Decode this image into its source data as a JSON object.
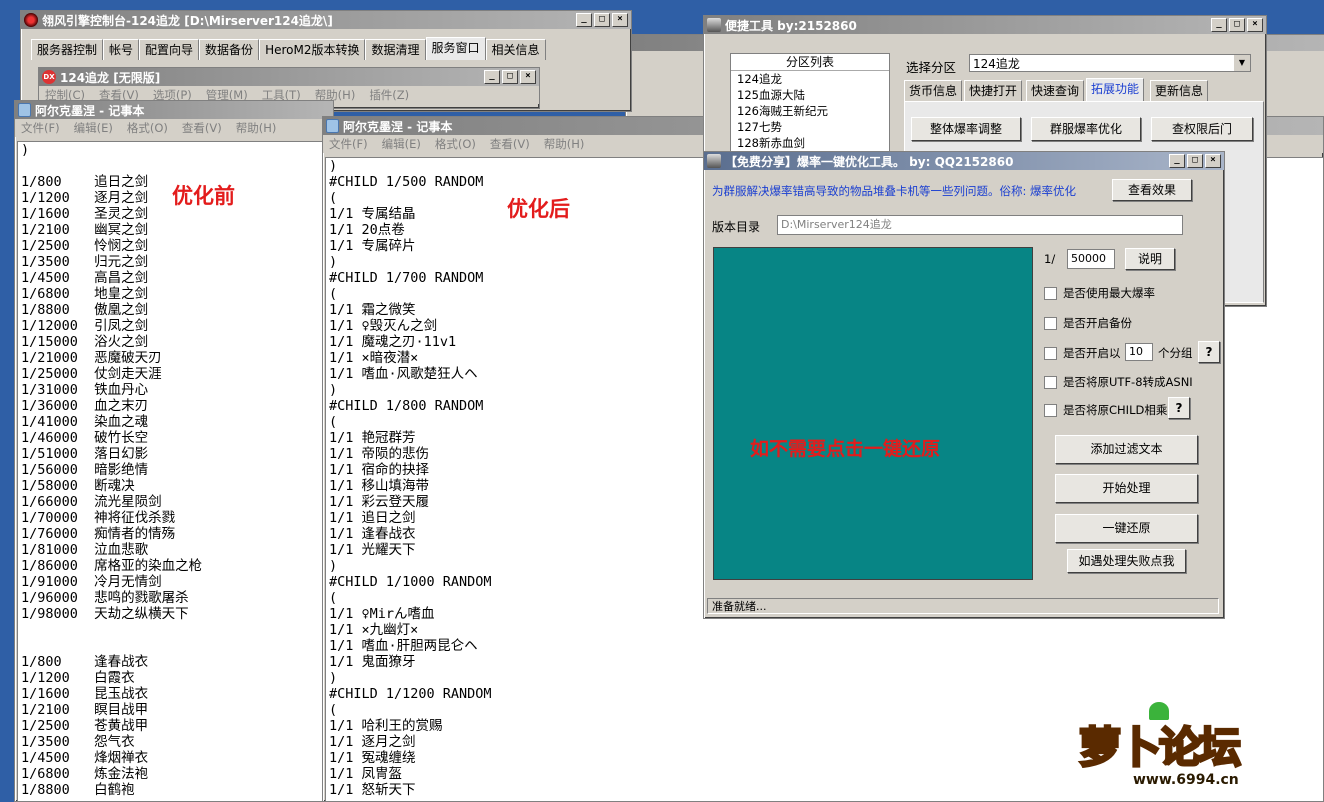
{
  "engine": {
    "title": "翎风引擎控制台-124追龙 [D:\\Mirserver124追龙\\]",
    "tabs": [
      "服务器控制",
      "帐号",
      "配置向导",
      "数据备份",
      "HeroM2版本转换",
      "数据清理",
      "服务窗口",
      "相关信息"
    ],
    "sub_title": "124追龙 [无限版]",
    "sub_menu": [
      "控制(C)",
      "查看(V)",
      "选项(P)",
      "管理(M)",
      "工具(T)",
      "帮助(H)",
      "插件(Z)"
    ]
  },
  "notepad_before": {
    "title": "阿尔克墨涅 - 记事本",
    "menu": [
      "文件(F)",
      "编辑(E)",
      "格式(O)",
      "查看(V)",
      "帮助(H)"
    ],
    "label": "优化前",
    "lines": [
      ")",
      "",
      "1/800    追日之剑",
      "1/1200   逐月之剑",
      "1/1600   圣灵之剑",
      "1/2100   幽冥之剑",
      "1/2500   怜悯之剑",
      "1/3500   归元之剑",
      "1/4500   高昌之剑",
      "1/6800   地皇之剑",
      "1/8800   傲凰之剑",
      "1/12000  引凤之剑",
      "1/15000  浴火之剑",
      "1/21000  恶魔破天刃",
      "1/25000  仗剑走天涯",
      "1/31000  铁血丹心",
      "1/36000  血之末刃",
      "1/41000  染血之魂",
      "1/46000  破竹长空",
      "1/51000  落日幻影",
      "1/56000  暗影绝情",
      "1/58000  断魂决",
      "1/66000  流光星陨剑",
      "1/70000  神将征伐杀戮",
      "1/76000  痴情者的情殇",
      "1/81000  泣血悲歌",
      "1/86000  席格亚的染血之枪",
      "1/91000  冷月无情剑",
      "1/96000  悲鸣的戮歌屠杀",
      "1/98000  天劫之纵横天下",
      "",
      "",
      "1/800    逢春战衣",
      "1/1200   白霞衣",
      "1/1600   昆玉战衣",
      "1/2100   瞑目战甲",
      "1/2500   苍黄战甲",
      "1/3500   怨气衣",
      "1/4500   烽烟禅衣",
      "1/6800   炼金法袍",
      "1/8800   白鹤袍"
    ]
  },
  "notepad_after": {
    "title": "阿尔克墨涅 - 记事本",
    "menu": [
      "文件(F)",
      "编辑(E)",
      "格式(O)",
      "查看(V)",
      "帮助(H)"
    ],
    "label": "优化后",
    "lines": [
      ")",
      "#CHILD 1/500 RANDOM",
      "(",
      "1/1 专属结晶",
      "1/1 20点卷",
      "1/1 专属碎片",
      ")",
      "#CHILD 1/700 RANDOM",
      "(",
      "1/1 霜之微笑",
      "1/1 ♀毁灭ん之剑",
      "1/1 魔魂之刃·11v1",
      "1/1 ×暗夜潜×",
      "1/1 嗜血·风歌楚狂人ヘ",
      ")",
      "#CHILD 1/800 RANDOM",
      "(",
      "1/1 艳冠群芳",
      "1/1 帝陨的悲伤",
      "1/1 宿命的抉择",
      "1/1 移山填海带",
      "1/1 彩云登天履",
      "1/1 追日之剑",
      "1/1 逢春战衣",
      "1/1 光耀天下",
      ")",
      "#CHILD 1/1000 RANDOM",
      "(",
      "1/1 ♀Mirん嗜血",
      "1/1 ×九幽灯×",
      "1/1 嗜血·肝胆两昆仑ヘ",
      "1/1 鬼面獠牙",
      ")",
      "#CHILD 1/1200 RANDOM",
      "(",
      "1/1 哈利王的赏赐",
      "1/1 逐月之剑",
      "1/1 冤魂缠绕",
      "1/1 凤冑盔",
      "1/1 怒斩天下"
    ]
  },
  "quick_tool": {
    "title": "便捷工具   by:2152860",
    "partition_header": "分区列表",
    "partitions": [
      "124追龙",
      "125血源大陆",
      "126海贼王新纪元",
      "127七势",
      "128新赤血剑"
    ],
    "select_label": "选择分区",
    "select_value": "124追龙",
    "tabs": [
      "货币信息",
      "快捷打开",
      "快速查询",
      "拓展功能",
      "更新信息"
    ],
    "buttons": [
      "整体爆率调整",
      "群服爆率优化",
      "查权限后门"
    ]
  },
  "optimizer": {
    "title": "【免费分享】爆率一键优化工具。   by: QQ2152860",
    "desc": "为群服解决爆率错高导致的物品堆叠卡机等一些列问题。俗称: 爆率优化",
    "view_effect": "查看效果",
    "dir_label": "版本目录",
    "dir_value": "D:\\Mirserver124追龙",
    "ratio_prefix": "1/",
    "ratio_value": "50000",
    "explain": "说明",
    "opt_max": "是否使用最大爆率",
    "opt_backup": "是否开启备份",
    "opt_group_a": "是否开启以",
    "group_value": "10",
    "opt_group_b": "个分组",
    "opt_utf8": "是否将原UTF-8转成ASNI",
    "opt_child": "是否将原CHILD相乘",
    "help_q": "?",
    "btn_filter": "添加过滤文本",
    "btn_start": "开始处理",
    "btn_restore": "一键还原",
    "btn_fail": "如遇处理失败点我",
    "panel_note": "如不需要点击一键还原",
    "status": "准备就绪..."
  },
  "watermark": {
    "logo_text": "萝卜论坛",
    "url": "www.6994.cn"
  },
  "colors": {
    "panel_teal": "#078585",
    "accent_red": "#e31c1c",
    "desktop_blue": "#2f5fa6",
    "link_blue": "#1b3fd1"
  }
}
